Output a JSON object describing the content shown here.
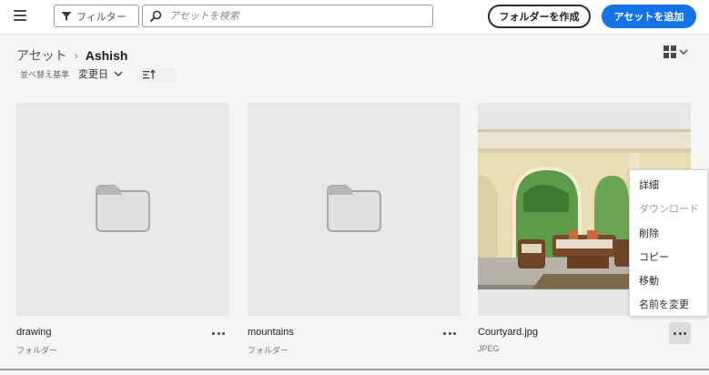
{
  "topbar": {
    "filter_label": "フィルター",
    "search_placeholder": "アセットを検索",
    "create_folder_label": "フォルダーを作成",
    "add_assets_label": "アセットを追加"
  },
  "breadcrumb": {
    "root": "アセット",
    "current": "Ashish"
  },
  "sort": {
    "label": "並べ替え基準",
    "value": "変更日"
  },
  "assets": [
    {
      "name": "drawing",
      "type": "フォルダー",
      "kind": "folder"
    },
    {
      "name": "mountains",
      "type": "フォルダー",
      "kind": "folder"
    },
    {
      "name": "Courtyard.jpg",
      "type": "JPEG",
      "kind": "image"
    }
  ],
  "context_menu": {
    "items": [
      {
        "label": "詳細",
        "enabled": true
      },
      {
        "label": "ダウンロード",
        "enabled": false
      },
      {
        "label": "削除",
        "enabled": true
      },
      {
        "label": "コピー",
        "enabled": true
      },
      {
        "label": "移動",
        "enabled": true
      },
      {
        "label": "名前を変更",
        "enabled": true
      }
    ]
  },
  "icons": {
    "menu": "hamburger-icon",
    "filter": "filter-icon",
    "search": "search-icon",
    "grid": "grid-view-icon",
    "sort": "sort-order-icon",
    "folder": "folder-icon",
    "more": "more-icon"
  },
  "colors": {
    "primary": "#1473e6",
    "tile_background": "#e8e8e8",
    "page_background": "#f5f5f5"
  }
}
